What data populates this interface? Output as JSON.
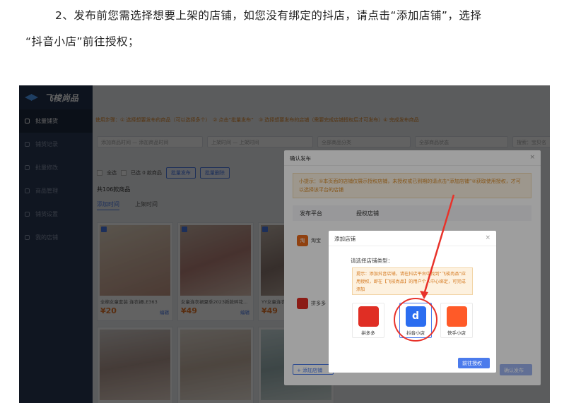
{
  "doc": {
    "line1": "2、发布前您需选择想要上架的店铺，如您没有绑定的抖店，请点击“添加店铺”，选择",
    "line2": "“抖音小店”前往授权；"
  },
  "app": {
    "brand": "飞梭尚品",
    "nav": [
      "批量铺货",
      "铺货记录",
      "批量修改",
      "商品管理",
      "铺货设置",
      "我的店铺"
    ],
    "tip": "使用步骤：① 选择想要发布的商品（可以选择多个）　② 点击“批量发布”　③ 选择想要发布的店铺（需要完成店铺授权后才可发布）④ 完成发布商品",
    "filters": [
      "添加商品时间 — 添加商品时间",
      "上架时间 — 上架时间",
      "全部商品分类",
      "全部商品状态",
      "搜索：宝贝名"
    ],
    "select_all": "全选",
    "selected": "已选 0 款商品",
    "batch_publish": "批量发布",
    "batch_delete": "批量删除",
    "count": "共106款商品",
    "sort_tabs": [
      "添加时间",
      "上架时间"
    ],
    "cards": [
      {
        "title": "全棉女童套装 连衣裙LE363",
        "price": "¥20",
        "edit": "编辑"
      },
      {
        "title": "女童连衣裙夏季2023新款碎花...",
        "price": "¥49",
        "edit": "编辑"
      },
      {
        "title": "YY女童连衣裙...",
        "price": "¥49",
        "edit": "编辑"
      }
    ]
  },
  "dialog_publish": {
    "title": "确认发布",
    "close": "×",
    "warning": "小提示：①本页面的店铺仅展示授权店铺，未授权或已到期的请点击“添加店铺”②获取使用授权，才可以选择该平台的店铺",
    "col_platform": "发布平台",
    "col_shop": "授权店铺",
    "row1_platform": "淘宝",
    "row1_shop": "二数码城",
    "row2_platform": "拼多多",
    "add_shop": "+ 添加店铺",
    "confirm": "确认发布"
  },
  "dialog_add": {
    "title": "添加店铺",
    "close": "×",
    "select_type": "请选择店铺类型：",
    "hint": "提示：添加抖音店铺，请在抖店平台中找到“飞梭尚品”应用授权，即在【飞梭尚品】的用户个人中心绑定，可完成添加",
    "options": [
      {
        "label": "拼多多",
        "icon": "pinduoduo-icon",
        "color": "#e02e24"
      },
      {
        "label": "抖音小店",
        "icon": "douyin-shop-icon",
        "color": "#2b6df0"
      },
      {
        "label": "快手小店",
        "icon": "kuaishou-icon",
        "color": "#ff5a28"
      }
    ],
    "go_auth": "前往授权"
  },
  "colors": {
    "accent": "#4b7bec",
    "annotation": "#e8322a",
    "sidebar": "#2b3a57"
  }
}
